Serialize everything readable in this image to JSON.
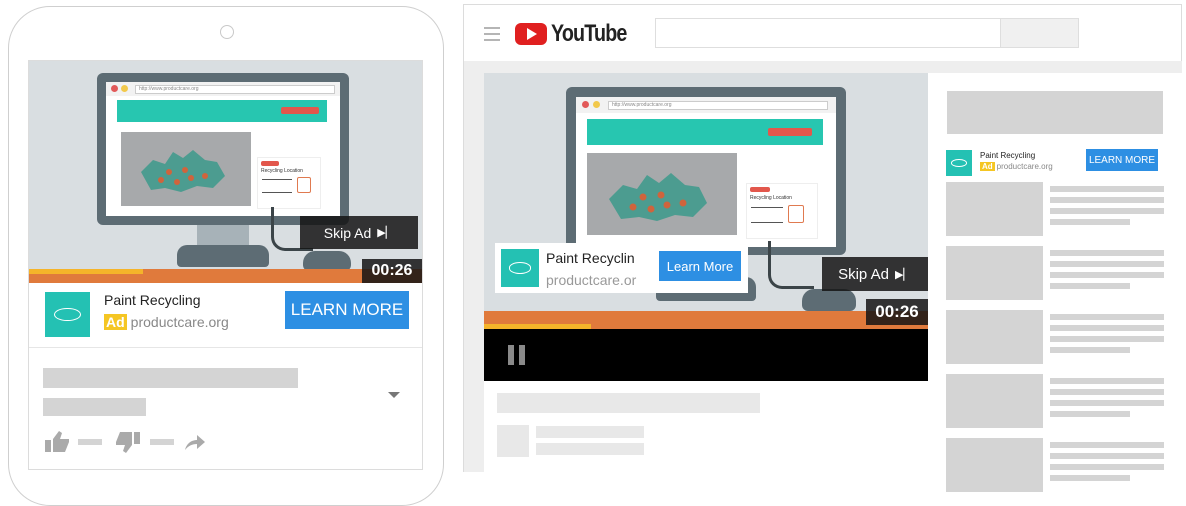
{
  "mobile": {
    "video": {
      "url_text": "http://www.productcare.org",
      "card_title": "Recycling Location",
      "skip_label": "Skip Ad",
      "skip_icon": "skip-next-icon",
      "timer": "00:26",
      "progress": 0.29
    },
    "ad": {
      "title": "Paint Recycling",
      "badge": "Ad",
      "domain": "productcare.org",
      "cta": "LEARN MORE"
    },
    "actions": {
      "like_icon": "thumbs-up-icon",
      "dislike_icon": "thumbs-down-icon",
      "share_icon": "share-arrow-icon",
      "expand_icon": "chevron-down-icon"
    }
  },
  "desktop": {
    "header": {
      "brand": "YouTube",
      "menu_icon": "hamburger-menu-icon",
      "logo_icon": "youtube-play-logo-icon"
    },
    "video": {
      "url_text": "http://www.productcare.org",
      "card_title": "Recycling Location",
      "skip_label": "Skip Ad",
      "skip_icon": "skip-next-icon",
      "timer": "00:26",
      "progress": 0.24,
      "pause_icon": "pause-icon"
    },
    "overlay_ad": {
      "title": "Paint Recyclin",
      "domain": "productcare.or",
      "cta": "Learn More"
    },
    "sidebar_ad": {
      "title": "Paint Recycling",
      "badge": "Ad",
      "domain": "productcare.org",
      "cta": "LEARN MORE"
    }
  },
  "colors": {
    "accent_blue": "#2d8fe3",
    "brand_teal": "#24c1b3",
    "ad_badge_yellow": "#f5c623",
    "youtube_red": "#e02020",
    "progress_orange": "#e07a3c",
    "progress_yellow": "#f5b42a"
  }
}
